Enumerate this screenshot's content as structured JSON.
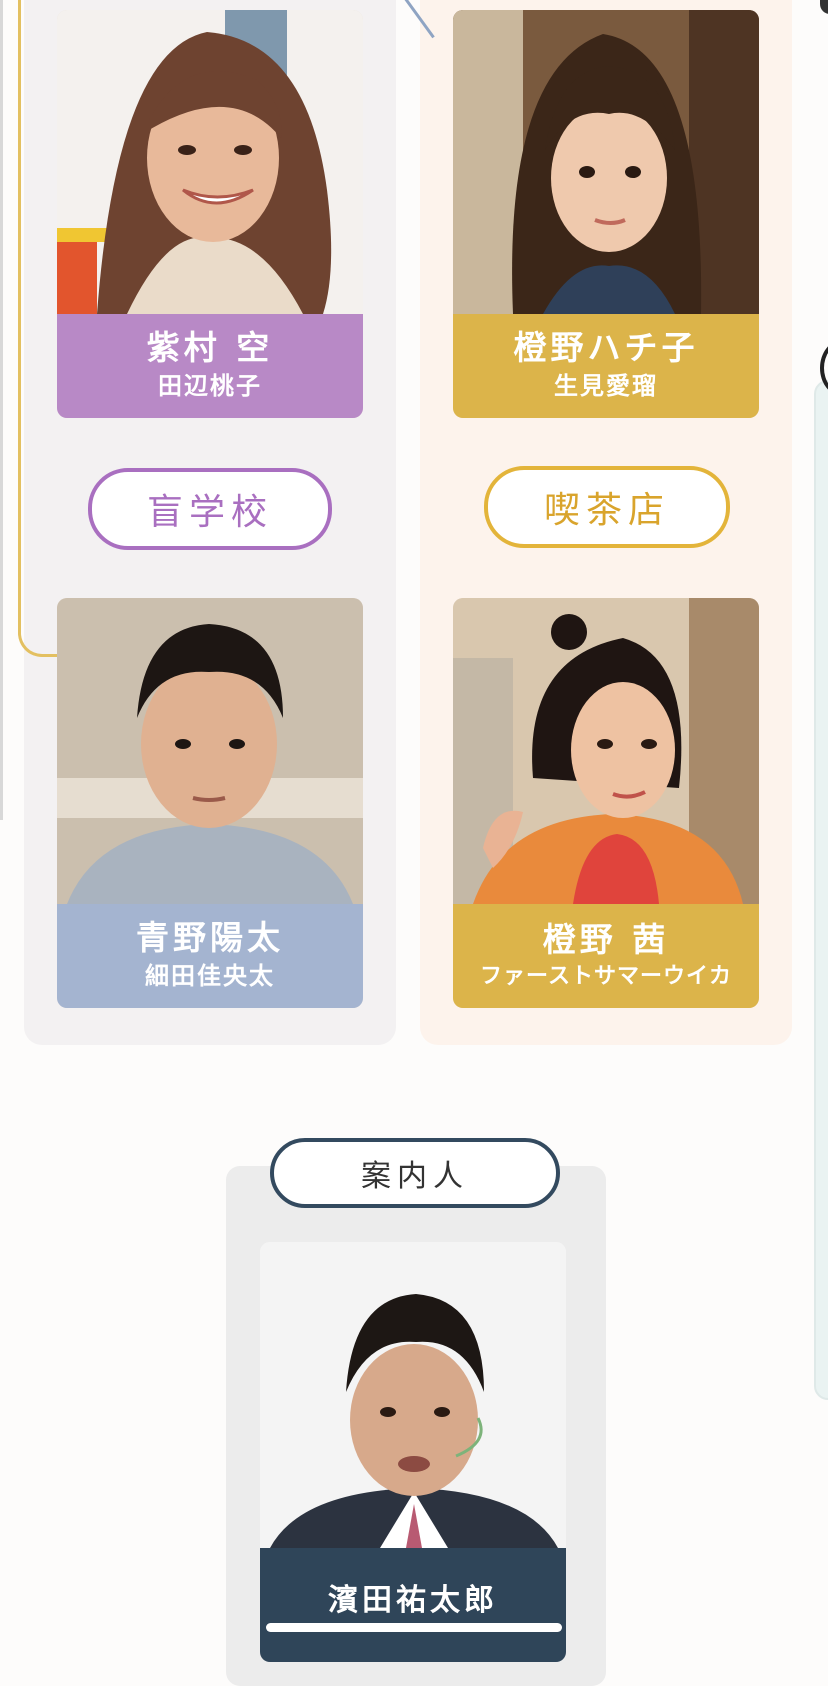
{
  "colors": {
    "purple": "#b889c6",
    "gold": "#dcb44a",
    "blue_grey": "#a4b4d0",
    "navy": "#2f4559",
    "pill_purple_border": "#a96fc0",
    "pill_gold_border": "#e3b43a",
    "pill_navy_border": "#334a5f"
  },
  "groups": {
    "school": {
      "label": "盲学校"
    },
    "cafe": {
      "label": "喫茶店"
    },
    "guide": {
      "label": "案内人"
    }
  },
  "characters": [
    {
      "role": "紫村 空",
      "actor": "田辺桃子",
      "group": "school"
    },
    {
      "role": "橙野ハチ子",
      "actor": "生見愛瑠",
      "group": "cafe"
    },
    {
      "role": "青野陽太",
      "actor": "細田佳央太",
      "group": "school"
    },
    {
      "role": "橙野 茜",
      "actor": "ファーストサマーウイカ",
      "group": "cafe"
    },
    {
      "role": "濱田祐太郎",
      "actor": "",
      "group": "guide"
    }
  ]
}
